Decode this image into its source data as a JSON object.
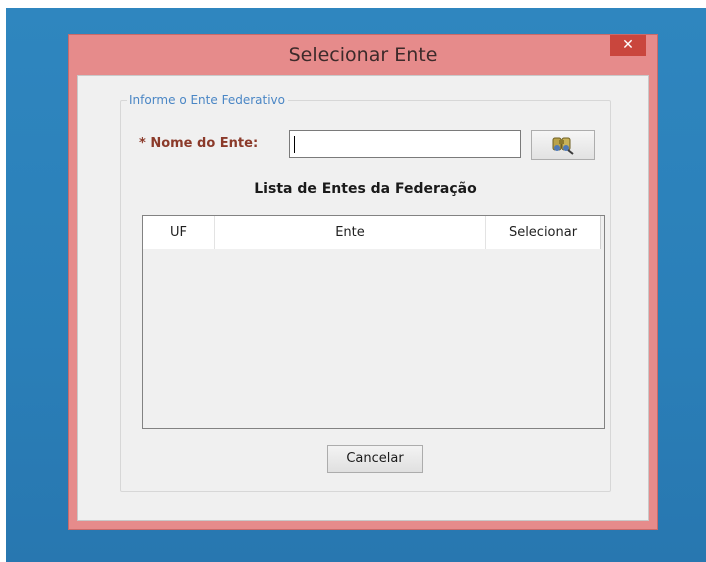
{
  "window": {
    "title": "Selecionar Ente",
    "close_symbol": "✕"
  },
  "form": {
    "group_label": "Informe o Ente Federativo",
    "name_label": "* Nome do Ente:",
    "name_value": "",
    "search_button_icon": "binoculars-search-icon"
  },
  "list": {
    "title": "Lista de Entes da Federação",
    "columns": [
      "UF",
      "Ente",
      "Selecionar"
    ],
    "rows": []
  },
  "actions": {
    "cancel_label": "Cancelar"
  },
  "colors": {
    "window_frame": "#e68b8b",
    "close_button": "#c9463d",
    "label_red": "#8b3a2a",
    "group_title_blue": "#4a86c5",
    "desktop": "#2f86bf"
  }
}
